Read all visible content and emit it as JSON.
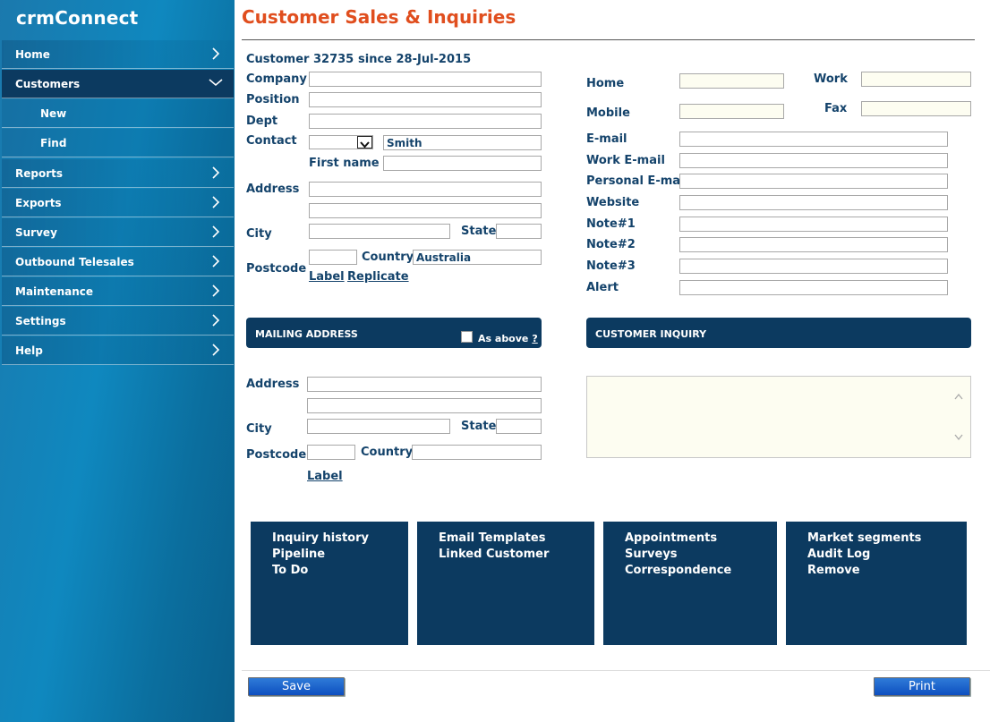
{
  "app": {
    "brand": "crmConnect",
    "title": "Customer Sales & Inquiries"
  },
  "sidebar": {
    "items": [
      {
        "label": "Home"
      },
      {
        "label": "Customers"
      },
      {
        "label": "New"
      },
      {
        "label": "Find"
      },
      {
        "label": "Reports"
      },
      {
        "label": "Exports"
      },
      {
        "label": "Survey"
      },
      {
        "label": "Outbound Telesales"
      },
      {
        "label": "Maintenance"
      },
      {
        "label": "Settings"
      },
      {
        "label": "Help"
      }
    ]
  },
  "customer": {
    "number_label": "Customer 32735",
    "since_label": "since 28-Jul-2015"
  },
  "form": {
    "company": {
      "label": "Company",
      "value": ""
    },
    "position": {
      "label": "Position",
      "value": ""
    },
    "dept": {
      "label": "Dept",
      "value": ""
    },
    "contact": {
      "label": "Contact",
      "title_value": "",
      "surname": "Smith"
    },
    "first_name": {
      "label": "First name",
      "value": ""
    },
    "address": {
      "label": "Address",
      "line1": "",
      "line2": ""
    },
    "city": {
      "label": "City",
      "value": ""
    },
    "state": {
      "label": "State",
      "value": ""
    },
    "postcode": {
      "label": "Postcode",
      "value": ""
    },
    "country": {
      "label": "Country",
      "value": "Australia"
    },
    "links": {
      "label": "Label",
      "replicate": "Replicate"
    }
  },
  "phones": {
    "home": {
      "label": "Home",
      "value": ""
    },
    "work": {
      "label": "Work",
      "value": ""
    },
    "mobile": {
      "label": "Mobile",
      "value": ""
    },
    "fax": {
      "label": "Fax",
      "value": ""
    },
    "email": {
      "label": "E-mail",
      "value": ""
    },
    "work_email": {
      "label": "Work E-mail",
      "value": ""
    },
    "personal_email": {
      "label": "Personal E-mail",
      "value": ""
    },
    "website": {
      "label": "Website",
      "value": ""
    },
    "note1": {
      "label": "Note#1",
      "value": ""
    },
    "note2": {
      "label": "Note#2",
      "value": ""
    },
    "note3": {
      "label": "Note#3",
      "value": ""
    },
    "alert": {
      "label": "Alert",
      "value": ""
    }
  },
  "mailing": {
    "header": "MAILING ADDRESS",
    "as_above": "As above",
    "help": "?",
    "address_label": "Address",
    "city_label": "City",
    "state_label": "State",
    "postcode_label": "Postcode",
    "country_label": "Country",
    "label_link": "Label"
  },
  "inquiry": {
    "header": "CUSTOMER INQUIRY",
    "value": ""
  },
  "boxes": [
    {
      "items": [
        "Inquiry history",
        "Pipeline",
        "To Do"
      ]
    },
    {
      "items": [
        "Email Templates",
        "Linked Customer"
      ]
    },
    {
      "items": [
        "Appointments",
        "Surveys",
        "Correspondence"
      ]
    },
    {
      "items": [
        "Market segments",
        "Audit Log",
        "Remove"
      ]
    }
  ],
  "buttons": {
    "save": "Save",
    "print": "Print"
  }
}
